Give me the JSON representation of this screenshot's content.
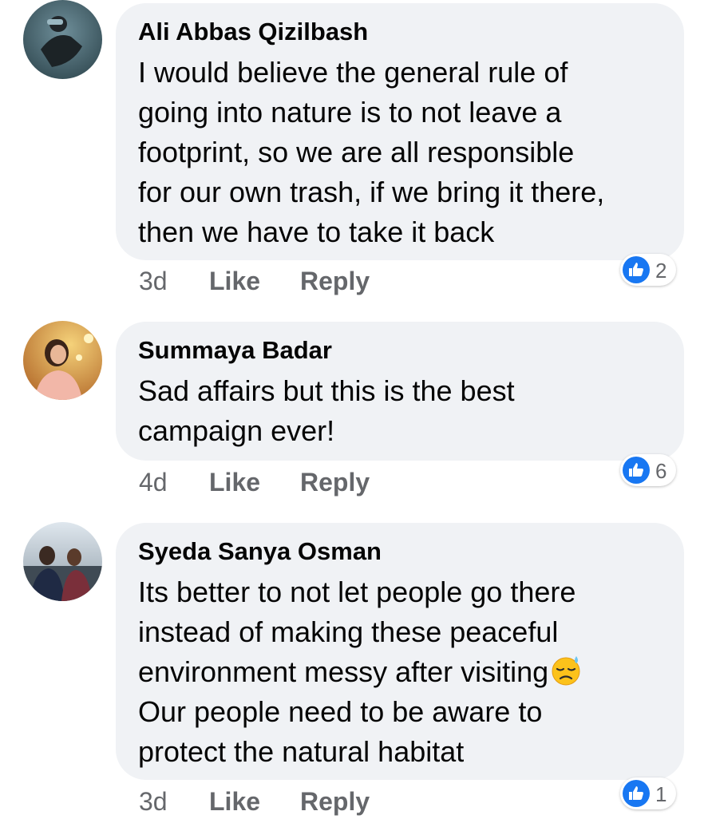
{
  "comments": [
    {
      "author": "Ali Abbas Qizilbash",
      "text": "I would believe the general rule of\ngoing into nature is to not leave a\nfootprint, so we are all responsible\nfor our own trash, if we bring it there,\nthen we have to take it back",
      "age": "3d",
      "like_label": "Like",
      "reply_label": "Reply",
      "reaction_count": "2"
    },
    {
      "author": "Summaya Badar",
      "text": "Sad affairs but this is the best\ncampaign ever!",
      "age": "4d",
      "like_label": "Like",
      "reply_label": "Reply",
      "reaction_count": "6"
    },
    {
      "author": "Syeda Sanya Osman",
      "text": "Its better to not let people go there\ninstead of making these peaceful\nenvironment messy after visiting",
      "text_after_emoji": "Our people need to be aware to\nprotect the natural habitat",
      "emoji": "downcast-face-with-sweat-icon",
      "age": "3d",
      "like_label": "Like",
      "reply_label": "Reply",
      "reaction_count": "1"
    }
  ],
  "colors": {
    "bubble": "#f0f2f5",
    "text": "#050505",
    "secondary": "#65676b",
    "like_blue": "#1877f2"
  }
}
